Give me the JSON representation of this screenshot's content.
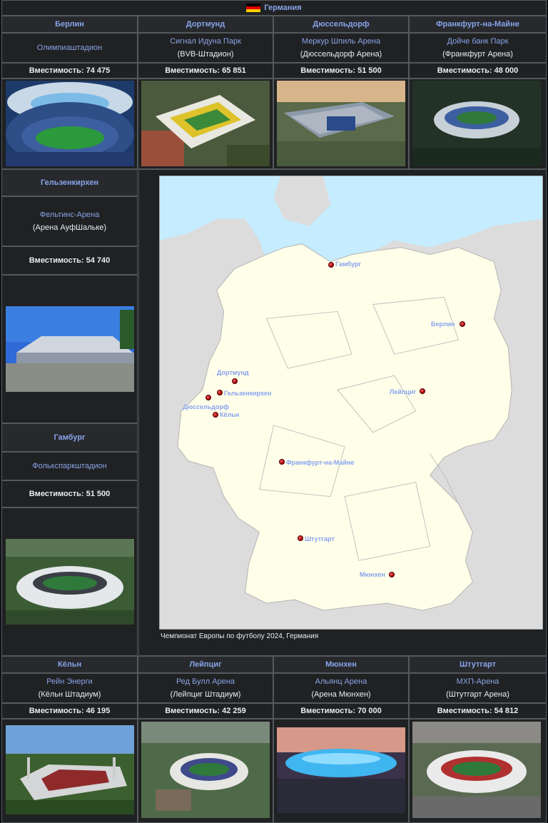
{
  "header": {
    "title": "Германия"
  },
  "top": [
    {
      "city": "Берлин",
      "stadium": "Олимпиаштадион",
      "alt": "",
      "capacity": "Вместимость: 74 475"
    },
    {
      "city": "Дортмунд",
      "stadium": "Сигнал Идуна Парк",
      "alt": "(BVB-Штадион)",
      "capacity": "Вместимость: 65 851"
    },
    {
      "city": "Дюссельдорф",
      "stadium": "Меркур Шпиль Арена",
      "alt": "(Дюссельдорф Арена)",
      "capacity": "Вместимость: 51 500"
    },
    {
      "city": "Франкфурт-на-Майне",
      "stadium": "Дойче банк Парк",
      "alt": "(Франкфурт Арена)",
      "capacity": "Вместимость: 48 000"
    }
  ],
  "left": [
    {
      "city": "Гельзенкирхен",
      "stadium": "Фельтинс-Арена",
      "alt": "(Арена АуфШальке)",
      "capacity": "Вместимость: 54 740"
    },
    {
      "city": "Гамбург",
      "stadium": "Фолькспаркштадион",
      "alt": "",
      "capacity": "Вместимость: 51 500"
    }
  ],
  "bottom": [
    {
      "city": "Кёльн",
      "stadium": "Рейн Энерги",
      "alt": "(Кёльн Штадиум)",
      "capacity": "Вместимость: 46 195"
    },
    {
      "city": "Лейпциг",
      "stadium": "Ред Булл Арена",
      "alt": "(Лейпциг Штадиум)",
      "capacity": "Вместимость: 42 259"
    },
    {
      "city": "Мюнхен",
      "stadium": "Альянц Арена",
      "alt": "(Арена Мюнхен)",
      "capacity": "Вместимость: 70 000"
    },
    {
      "city": "Штутгарт",
      "stadium": "МХП-Арена",
      "alt": "(Штутгарт Арена)",
      "capacity": "Вместимость: 54 812"
    }
  ],
  "map": {
    "caption": "Чемпионат Европы по футболу 2024, Германия",
    "cities": [
      {
        "name": "Гамбург"
      },
      {
        "name": "Берлин"
      },
      {
        "name": "Дортмунд"
      },
      {
        "name": "Гельзенкирхен"
      },
      {
        "name": "Дюссельдорф"
      },
      {
        "name": "Кёльн"
      },
      {
        "name": "Лейпциг"
      },
      {
        "name": "Франкфурт-на-Майне"
      },
      {
        "name": "Штутгарт"
      },
      {
        "name": "Мюнхен"
      }
    ]
  },
  "colors": {
    "link": "#88a3e8",
    "background": "#202122",
    "border": "#54595d",
    "land": "#fefee9",
    "sea": "#c6ecff"
  }
}
